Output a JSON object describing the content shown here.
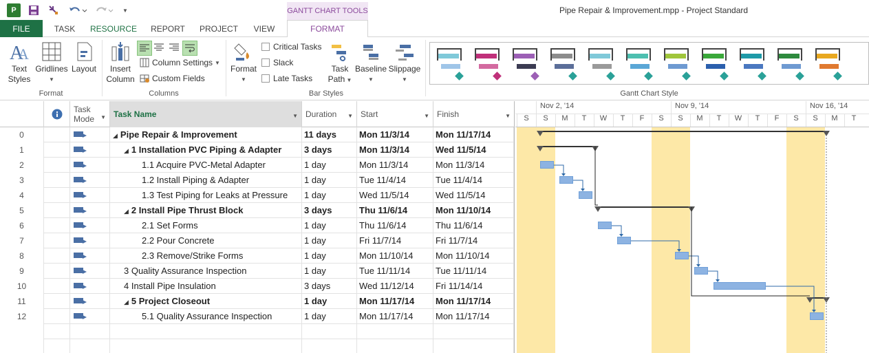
{
  "titlebar": {
    "app_icon_label": "P",
    "contextual_tab": "GANTT CHART TOOLS",
    "window_title": "Pipe Repair & Improvement.mpp - Project Standard"
  },
  "tabs": {
    "file": "FILE",
    "task": "TASK",
    "resource": "RESOURCE",
    "report": "REPORT",
    "project": "PROJECT",
    "view": "VIEW",
    "format": "FORMAT"
  },
  "ribbon": {
    "format_group": {
      "label": "Format",
      "text_styles": "Text\nStyles",
      "text_styles_line1": "Text",
      "text_styles_line2": "Styles",
      "gridlines": "Gridlines",
      "layout": "Layout"
    },
    "columns_group": {
      "label": "Columns",
      "insert_line1": "Insert",
      "insert_line2": "Column",
      "column_settings": "Column Settings",
      "custom_fields": "Custom Fields"
    },
    "bar_styles_group": {
      "label": "Bar Styles",
      "format": "Format",
      "critical_tasks": "Critical Tasks",
      "slack": "Slack",
      "late_tasks": "Late Tasks",
      "task_path_line1": "Task",
      "task_path_line2": "Path",
      "baseline": "Baseline",
      "slippage": "Slippage"
    },
    "gantt_style_group": {
      "label": "Gantt Chart Style",
      "styles": [
        {
          "top": "#7fc9d9",
          "bottom": "#9fc5e8",
          "diamond": "#2aa198"
        },
        {
          "top": "#c0307a",
          "bottom": "#d36aa0",
          "diamond": "#c0307a"
        },
        {
          "top": "#9c5fb5",
          "bottom": "#3b3b52",
          "diamond": "#9c5fb5"
        },
        {
          "top": "#8c8c8c",
          "bottom": "#5b6e99",
          "diamond": "#2aa198"
        },
        {
          "top": "#7fc9d9",
          "bottom": "#9a9a9a",
          "diamond": "#2aa198"
        },
        {
          "top": "#4dbfb0",
          "bottom": "#5aa7d6",
          "diamond": "#2aa198"
        },
        {
          "top": "#a0c63b",
          "bottom": "#6e9ad1",
          "diamond": "#2aa198"
        },
        {
          "top": "#3aa83a",
          "bottom": "#2b5fad",
          "diamond": "#2aa198"
        },
        {
          "top": "#1e9aa8",
          "bottom": "#4a78c0",
          "diamond": "#2aa198"
        },
        {
          "top": "#2e8a3e",
          "bottom": "#6e9ad1",
          "diamond": "#2aa198"
        },
        {
          "top": "#e8a820",
          "bottom": "#e07a30",
          "diamond": "#2aa198"
        }
      ]
    }
  },
  "grid": {
    "headers": {
      "task_mode": "Task\nMode",
      "task_mode_line1": "Task",
      "task_mode_line2": "Mode",
      "task_name": "Task Name",
      "duration": "Duration",
      "start": "Start",
      "finish": "Finish"
    },
    "rows": [
      {
        "id": "0",
        "name": "Pipe Repair & Improvement",
        "indent": 0,
        "summary": true,
        "duration": "11 days",
        "start": "Mon 11/3/14",
        "finish": "Mon 11/17/14"
      },
      {
        "id": "1",
        "name": "1 Installation PVC Piping & Adapter",
        "indent": 1,
        "summary": true,
        "duration": "3 days",
        "start": "Mon 11/3/14",
        "finish": "Wed 11/5/14"
      },
      {
        "id": "2",
        "name": "1.1 Acquire PVC-Metal Adapter",
        "indent": 2,
        "summary": false,
        "duration": "1 day",
        "start": "Mon 11/3/14",
        "finish": "Mon 11/3/14"
      },
      {
        "id": "3",
        "name": "1.2 Install Piping & Adapter",
        "indent": 2,
        "summary": false,
        "duration": "1 day",
        "start": "Tue 11/4/14",
        "finish": "Tue 11/4/14"
      },
      {
        "id": "4",
        "name": "1.3 Test Piping for Leaks at Pressure",
        "indent": 2,
        "summary": false,
        "duration": "1 day",
        "start": "Wed 11/5/14",
        "finish": "Wed 11/5/14"
      },
      {
        "id": "5",
        "name": "2 Install Pipe Thrust Block",
        "indent": 1,
        "summary": true,
        "duration": "3 days",
        "start": "Thu 11/6/14",
        "finish": "Mon 11/10/14"
      },
      {
        "id": "6",
        "name": "2.1 Set Forms",
        "indent": 2,
        "summary": false,
        "duration": "1 day",
        "start": "Thu 11/6/14",
        "finish": "Thu 11/6/14"
      },
      {
        "id": "7",
        "name": "2.2 Pour Concrete",
        "indent": 2,
        "summary": false,
        "duration": "1 day",
        "start": "Fri 11/7/14",
        "finish": "Fri 11/7/14"
      },
      {
        "id": "8",
        "name": "2.3 Remove/Strike Forms",
        "indent": 2,
        "summary": false,
        "duration": "1 day",
        "start": "Mon 11/10/14",
        "finish": "Mon 11/10/14"
      },
      {
        "id": "9",
        "name": "3 Quality Assurance Inspection",
        "indent": 1,
        "summary": false,
        "duration": "1 day",
        "start": "Tue 11/11/14",
        "finish": "Tue 11/11/14"
      },
      {
        "id": "10",
        "name": "4 Install Pipe Insulation",
        "indent": 1,
        "summary": false,
        "duration": "3 days",
        "start": "Wed 11/12/14",
        "finish": "Fri 11/14/14"
      },
      {
        "id": "11",
        "name": "5 Project Closeout",
        "indent": 1,
        "summary": true,
        "duration": "1 day",
        "start": "Mon 11/17/14",
        "finish": "Mon 11/17/14"
      },
      {
        "id": "12",
        "name": "5.1 Quality Assurance Inspection",
        "indent": 2,
        "summary": false,
        "duration": "1 day",
        "start": "Mon 11/17/14",
        "finish": "Mon 11/17/14"
      }
    ]
  },
  "gantt": {
    "weeks": [
      "Nov 2, '14",
      "Nov 9, '14",
      "Nov 16, '14"
    ],
    "days": [
      "S",
      "S",
      "M",
      "T",
      "W",
      "T",
      "F",
      "S",
      "S",
      "M",
      "T",
      "W",
      "T",
      "F",
      "S",
      "S",
      "M",
      "T"
    ],
    "nonwork_color": "#fde8a7",
    "bar_color": "#8db3e2"
  }
}
